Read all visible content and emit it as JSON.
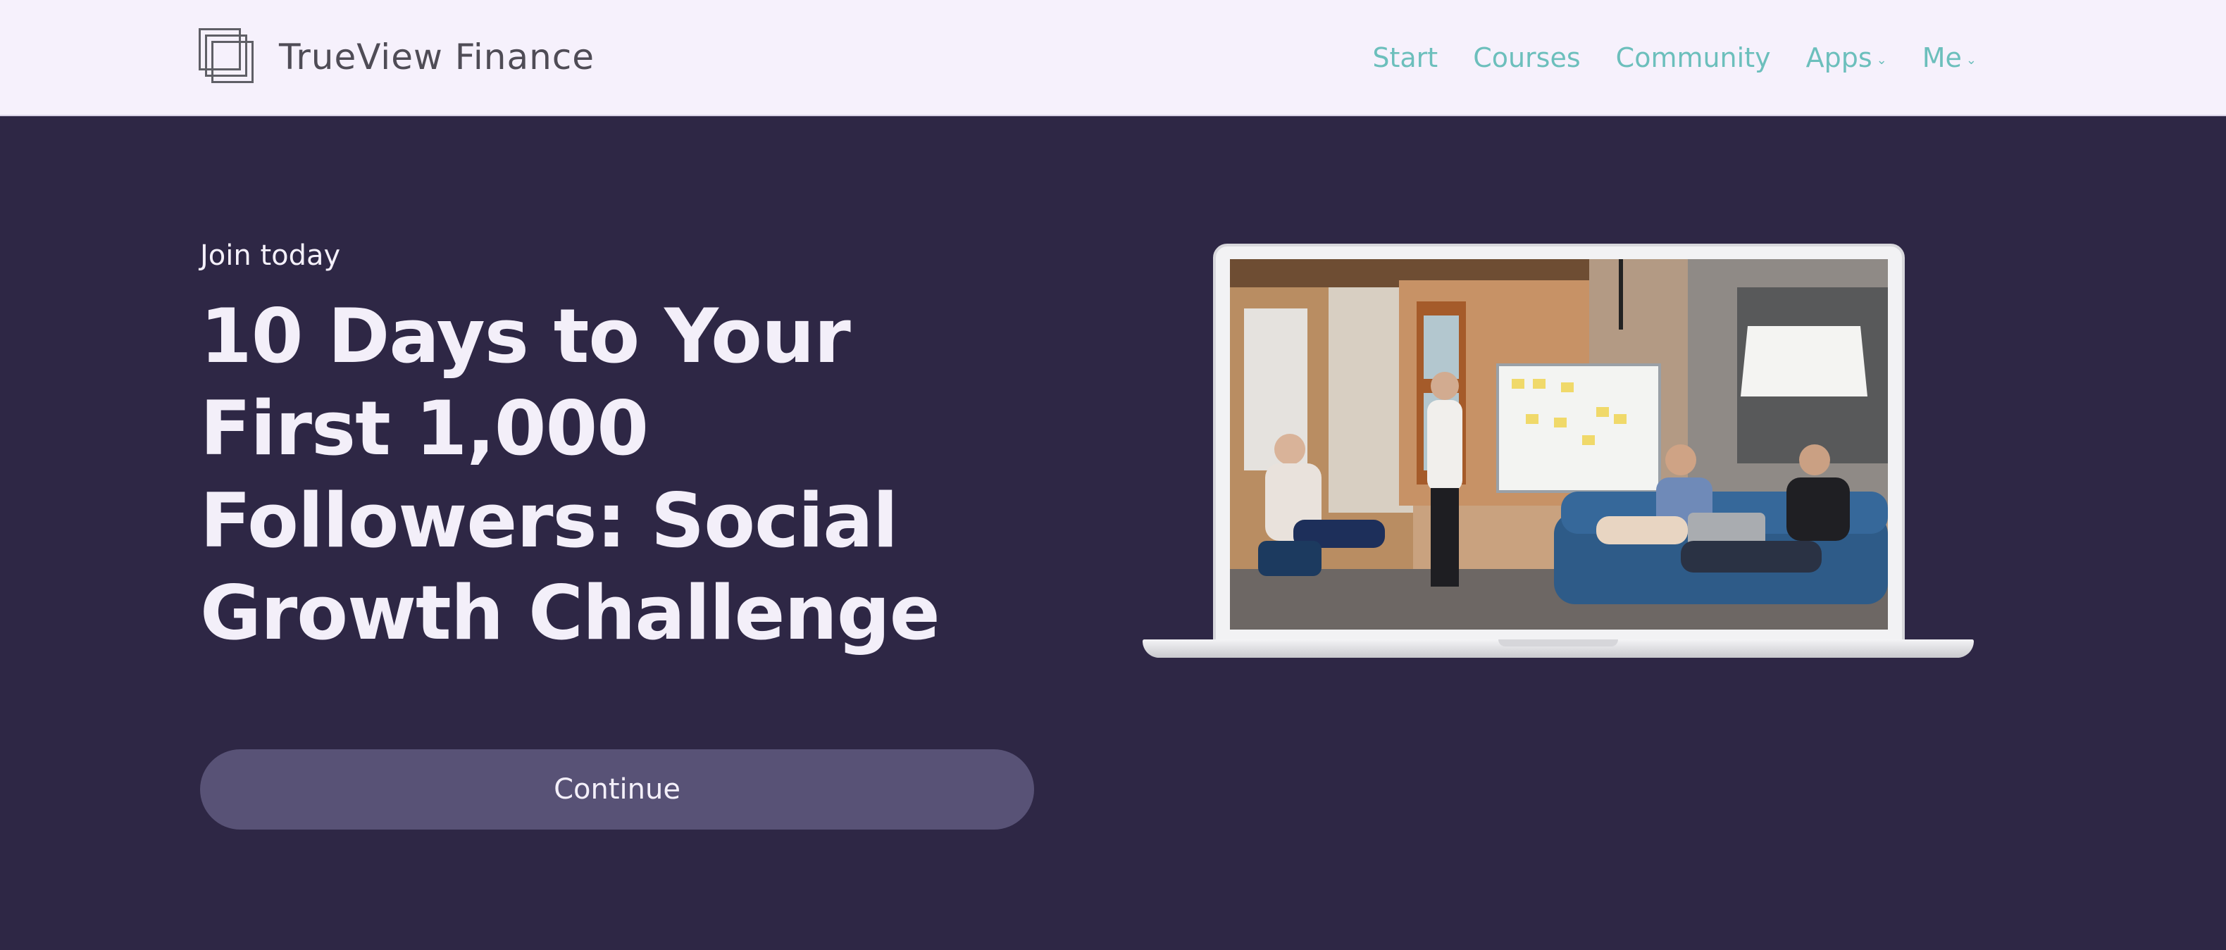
{
  "brand": {
    "name": "TrueView Finance",
    "icon": "stacked-squares-logo"
  },
  "nav": {
    "items": [
      {
        "label": "Start",
        "has_dropdown": false
      },
      {
        "label": "Courses",
        "has_dropdown": false
      },
      {
        "label": "Community",
        "has_dropdown": false
      },
      {
        "label": "Apps",
        "has_dropdown": true
      },
      {
        "label": "Me",
        "has_dropdown": true
      }
    ],
    "dropdown_glyph": "⌄"
  },
  "hero": {
    "eyebrow": "Join today",
    "headline": "10 Days to Your First 1,000 Followers: Social Growth Challenge",
    "cta_label": "Continue",
    "image_alt": "team-meeting-on-laptop-screen"
  },
  "colors": {
    "header_bg": "#f6f1fc",
    "hero_bg": "#2e2745",
    "nav_link": "#6cbfbc",
    "cta_bg": "#585276",
    "text_light": "#f3eff9"
  }
}
